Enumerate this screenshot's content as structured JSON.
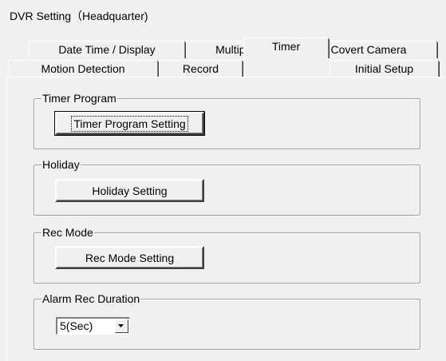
{
  "window": {
    "title": "DVR Setting（Headquarter)"
  },
  "tabs": {
    "row_back": [
      {
        "label": "Date Time / Display"
      },
      {
        "label": "Multiplexer"
      },
      {
        "label": "Covert Camera"
      }
    ],
    "row_front": [
      {
        "label": "Motion Detection"
      },
      {
        "label": "Record"
      },
      {
        "label": "Timer",
        "selected": true
      },
      {
        "label": "Initial Setup"
      }
    ]
  },
  "groups": {
    "timer_program": {
      "title": "Timer Program",
      "button": "Timer Program Setting"
    },
    "holiday": {
      "title": "Holiday",
      "button": "Holiday Setting"
    },
    "rec_mode": {
      "title": "Rec Mode",
      "button": "Rec Mode Setting"
    },
    "alarm_rec_duration": {
      "title": "Alarm Rec Duration",
      "selected_value": "5(Sec)"
    }
  }
}
